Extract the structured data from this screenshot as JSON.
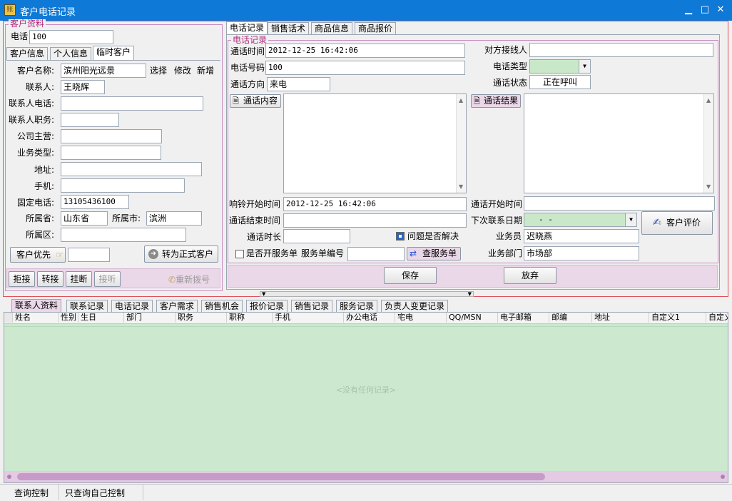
{
  "window": {
    "title": "客户电话记录",
    "app_icon": "app-icon",
    "min": "▁",
    "max": "□",
    "close": "✕"
  },
  "colors": {
    "titlebar": "#0e79d6",
    "frame_red": "#e0505a",
    "group_pink": "#c68bc0",
    "grid_green": "#cce8cf",
    "highlight_green": "#c9e8c9",
    "scroll_pink": "#c89ac8"
  },
  "customer": {
    "group_title": "客户资料",
    "phone_label": "电话",
    "phone_value": "100",
    "tabs": [
      "客户信息",
      "个人信息",
      "临时客户"
    ],
    "name_label": "客户名称:",
    "name_value": "滨州阳光远景",
    "select": "选择",
    "edit": "修改",
    "add": "新增",
    "contact_label": "联系人:",
    "contact_value": "王晓辉",
    "contact_phone_label": "联系人电话:",
    "contact_title_label": "联系人职务:",
    "business_label": "公司主营:",
    "biztype_label": "业务类型:",
    "address_label": "地址:",
    "mobile_label": "手机:",
    "landline_label": "固定电话:",
    "landline_value": "13105436100",
    "province_label": "所属省:",
    "province_value": "山东省",
    "city_label": "所属市:",
    "city_value": "滨洲",
    "district_label": "所属区:",
    "priority_button": "客户优先",
    "convert_button": "转为正式客户"
  },
  "call_controls": {
    "reject": "拒接",
    "transfer": "转接",
    "hangup": "挂断",
    "answer": "接听",
    "redial": "重新拨号"
  },
  "right_tabs": [
    "电话记录",
    "销售话术",
    "商品信息",
    "商品报价"
  ],
  "call": {
    "group_title": "电话记录",
    "time_label": "通话时间",
    "time_value": "2012-12-25 16:42:06",
    "other_party_label": "对方接线人",
    "number_label": "电话号码",
    "number_value": "100",
    "type_label": "电话类型",
    "direction_label": "通话方向",
    "direction_value": "来电",
    "status_label": "通话状态",
    "status_value": "正在呼叫",
    "content_button": "通话内容",
    "result_button": "通话结果",
    "ring_label": "响铃开始时间",
    "ring_value": "2012-12-25 16:42:06",
    "start_label": "通话开始时间",
    "end_label": "通话结束时间",
    "next_label": "下次联系日期",
    "next_value": "  -  -",
    "duration_label": "通话时长",
    "resolved_label": "问题是否解决",
    "service_open_label": "是否开服务单",
    "service_no_label": "服务单编号",
    "lookup_service": "查服务单",
    "evaluate": "客户评价",
    "salesman_label": "业务员",
    "salesman_value": "迟晓燕",
    "dept_label": "业务部门",
    "dept_value": "市场部",
    "save": "保存",
    "cancel": "放弃"
  },
  "bottom_tabs": [
    "联系人资料",
    "联系记录",
    "电话记录",
    "客户需求",
    "销售机会",
    "报价记录",
    "销售记录",
    "服务记录",
    "负责人变更记录"
  ],
  "grid": {
    "columns": [
      "姓名",
      "性别",
      "生日",
      "部门",
      "职务",
      "职称",
      "手机",
      "办公电话",
      "宅电",
      "QQ/MSN",
      "电子邮箱",
      "邮编",
      "地址",
      "自定义1",
      "自定义"
    ],
    "empty_text": "<没有任何记录>"
  },
  "status_bar": {
    "query_control": "查询控制",
    "own_control": "只查询自己控制"
  }
}
